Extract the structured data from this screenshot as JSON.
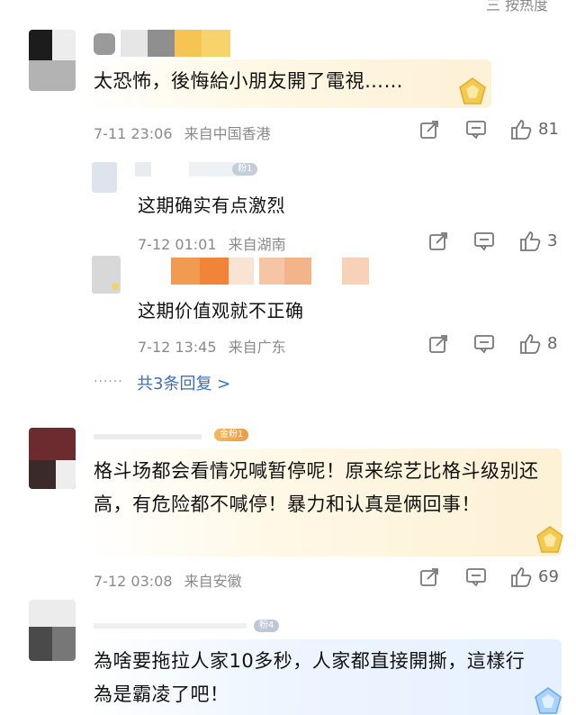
{
  "top_cutoff": "三 按热度",
  "comments": [
    {
      "text": "太恐怖，後悔給小朋友開了電視……",
      "time": "7-11 23:06",
      "location": "来自中国香港",
      "likes": "81"
    },
    {
      "text": "格斗场都会看情况喊暂停呢！原来综艺比格斗级别还高，有危险都不喊停！暴力和认真是俩回事！",
      "time": "7-12 03:08",
      "location": "来自安徽",
      "likes": "69",
      "badge": "金粉1"
    },
    {
      "text": "為啥要拖拉人家10多秒，人家都直接開撕，這樣行為是霸凌了吧！",
      "badge": "粉4"
    }
  ],
  "replies": [
    {
      "text": "这期确实有点激烈",
      "time": "7-12 01:01",
      "location": "来自湖南",
      "likes": "3",
      "badge": "粉1"
    },
    {
      "text": "这期价值观就不正确",
      "time": "7-12 13:45",
      "location": "来自广东",
      "likes": "8"
    }
  ],
  "more_replies": "共3条回复 >",
  "icons": [
    "share-icon",
    "comment-icon",
    "like-icon",
    "diamond-badge-icon"
  ],
  "colors": {
    "link": "#3b6fb6",
    "meta": "#8a8a8a",
    "gold": "#f0c24a"
  }
}
